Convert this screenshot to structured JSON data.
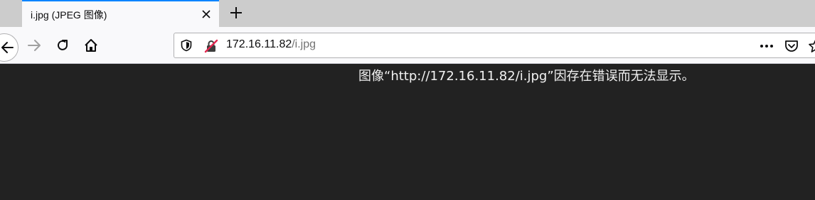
{
  "tab": {
    "title": "i.jpg (JPEG 图像)"
  },
  "toolbar": {
    "back_icon": "back-arrow-icon",
    "forward_icon": "forward-arrow-icon",
    "reload_icon": "reload-icon",
    "home_icon": "home-icon"
  },
  "urlbar": {
    "host": "172.16.11.82",
    "path": "/i.jpg",
    "accent": "#0a84ff"
  },
  "content": {
    "error_message": "图像“http://172.16.11.82/i.jpg”因存在错误而无法显示。",
    "background": "#222222"
  }
}
